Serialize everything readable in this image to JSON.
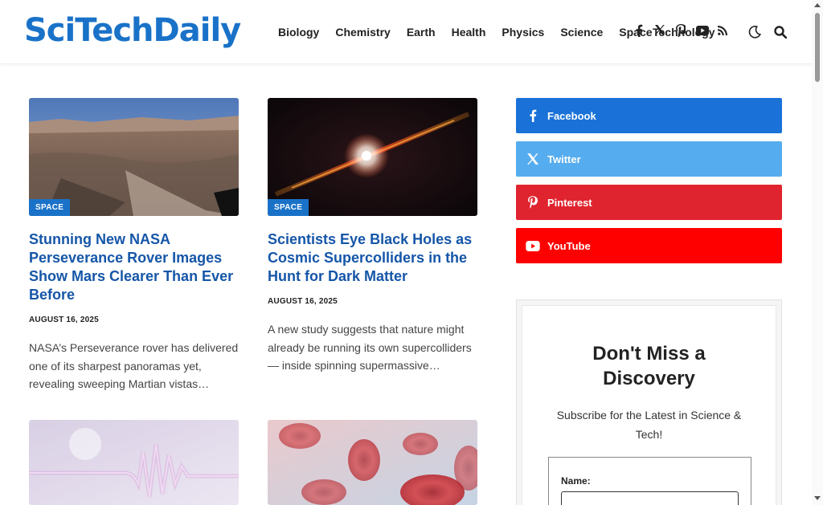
{
  "header": {
    "logo": {
      "part1": "Sci",
      "part2": "Tech",
      "part3": "Daily"
    },
    "nav": [
      {
        "label": "Biology"
      },
      {
        "label": "Chemistry"
      },
      {
        "label": "Earth"
      },
      {
        "label": "Health"
      },
      {
        "label": "Physics"
      },
      {
        "label": "Science"
      },
      {
        "label": "Space"
      },
      {
        "label": "Technology"
      }
    ],
    "social_icons": [
      "facebook-icon",
      "x-twitter-icon",
      "pinterest-icon",
      "youtube-icon",
      "rss-icon"
    ],
    "dark_mode_icon": "moon-icon",
    "search_icon": "search-icon"
  },
  "articles": [
    {
      "category": "SPACE",
      "title": "Stunning New NASA Perseverance Rover Images Show Mars Clearer Than Ever Before",
      "date": "AUGUST 16, 2025",
      "excerpt": "NASA’s Perseverance rover has delivered one of its sharpest panoramas yet, revealing sweeping Martian vistas…"
    },
    {
      "category": "SPACE",
      "title": "Scientists Eye Black Holes as Cosmic Supercolliders in the Hunt for Dark Matter",
      "date": "AUGUST 16, 2025",
      "excerpt": "A new study suggests that nature might already be running its own supercolliders — inside spinning supermassive…"
    }
  ],
  "sidebar": {
    "social": [
      {
        "label": "Facebook",
        "color": "#1a72d8",
        "icon": "facebook-icon"
      },
      {
        "label": "Twitter",
        "color": "#55acee",
        "icon": "x-twitter-icon"
      },
      {
        "label": "Pinterest",
        "color": "#e0242f",
        "icon": "pinterest-icon"
      },
      {
        "label": "YouTube",
        "color": "#fe0000",
        "icon": "youtube-icon"
      }
    ],
    "subscribe": {
      "heading": "Don't Miss a Discovery",
      "text": "Subscribe for the Latest in Science & Tech!",
      "name_label": "Name:"
    }
  },
  "colors": {
    "brand": "#1a72c8",
    "headline": "#1556a8"
  }
}
